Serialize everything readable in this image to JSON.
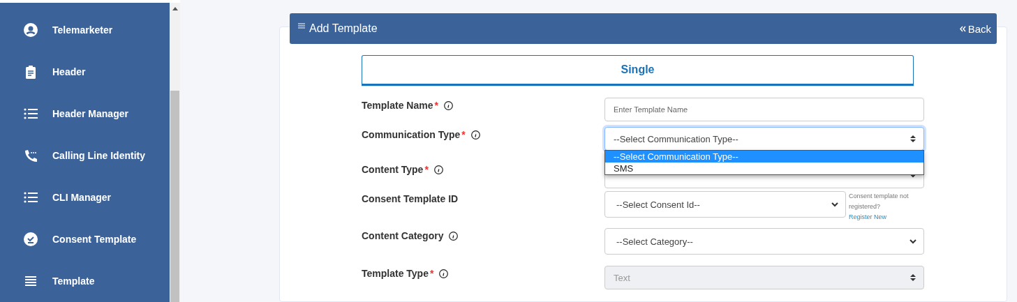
{
  "sidebar": {
    "items": [
      {
        "label": "Telemarketer"
      },
      {
        "label": "Header"
      },
      {
        "label": "Header Manager"
      },
      {
        "label": "Calling Line Identity"
      },
      {
        "label": "CLI Manager"
      },
      {
        "label": "Consent Template"
      },
      {
        "label": "Template"
      }
    ]
  },
  "panel": {
    "title": "Add Template",
    "back": "Back"
  },
  "tabs": [
    {
      "label": "Single",
      "selected": true
    }
  ],
  "form": {
    "fields": [
      {
        "kind": "input",
        "label": "Template Name",
        "required_mark": "*",
        "info": true,
        "placeholder": "Enter Template Name"
      },
      {
        "kind": "spinner",
        "label": "Communication Type",
        "required_mark": "*",
        "info": true,
        "value": "--Select Communication Type--",
        "focused": true,
        "expanded": true,
        "options": [
          {
            "label": "--Select Communication Type--",
            "selected": true
          },
          {
            "label": "SMS",
            "selected": false
          }
        ]
      },
      {
        "kind": "select",
        "label": "Content Type",
        "required_mark": "*",
        "info": true
      },
      {
        "kind": "select",
        "label": "Consent Template ID",
        "value": "--Select Consent Id--",
        "note": "Consent template not registered?",
        "link": "Register New"
      },
      {
        "kind": "select",
        "label": "Content Category",
        "info": true,
        "value": "--Select Category--"
      },
      {
        "kind": "spinner",
        "label": "Template Type",
        "required_mark": "*",
        "info": true,
        "value": "Text",
        "disabled": true
      }
    ]
  }
}
